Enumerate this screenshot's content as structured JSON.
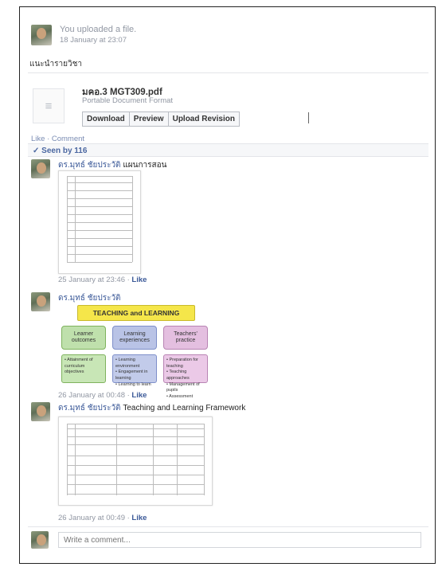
{
  "post": {
    "header_text": "You uploaded a file.",
    "timestamp": "18 January at 23:07",
    "body_text": "แนะนำรายวิชา"
  },
  "file": {
    "name": "มคอ.3 MGT309.pdf",
    "type": "Portable Document Format",
    "buttons": [
      "Download",
      "Preview",
      "Upload Revision"
    ],
    "icon": "document-icon"
  },
  "actions": {
    "like_comment": "Like · Comment"
  },
  "seen": {
    "label": "✓ Seen by 116"
  },
  "comments": [
    {
      "author": "ดร.มุทธ์ ชัยประวัติ",
      "text": "แผนการสอน",
      "meta": "25 January at 23:46 · ",
      "like": "Like"
    },
    {
      "author": "ดร.มุทธ์ ชัยประวัติ",
      "text": "",
      "meta": "26 January at 00:48 · ",
      "like": "Like",
      "diagram": {
        "title": "TEACHING and LEARNING",
        "boxes": [
          "Learner outcomes",
          "Learning experiences",
          "Teachers' practice"
        ],
        "lists": [
          [
            "• Attainment of curriculum objectives"
          ],
          [
            "• Learning environment",
            "• Engagement in learning",
            "• Learning to learn"
          ],
          [
            "• Preparation for teaching",
            "• Teaching approaches",
            "• Management of pupils",
            "• Assessment"
          ]
        ]
      }
    },
    {
      "author": "ดร.มุทธ์ ชัยประวัติ",
      "text": "Teaching and Learning Framework",
      "meta": "26 January at 00:49 · ",
      "like": "Like"
    }
  ],
  "composer": {
    "placeholder": "Write a comment..."
  }
}
